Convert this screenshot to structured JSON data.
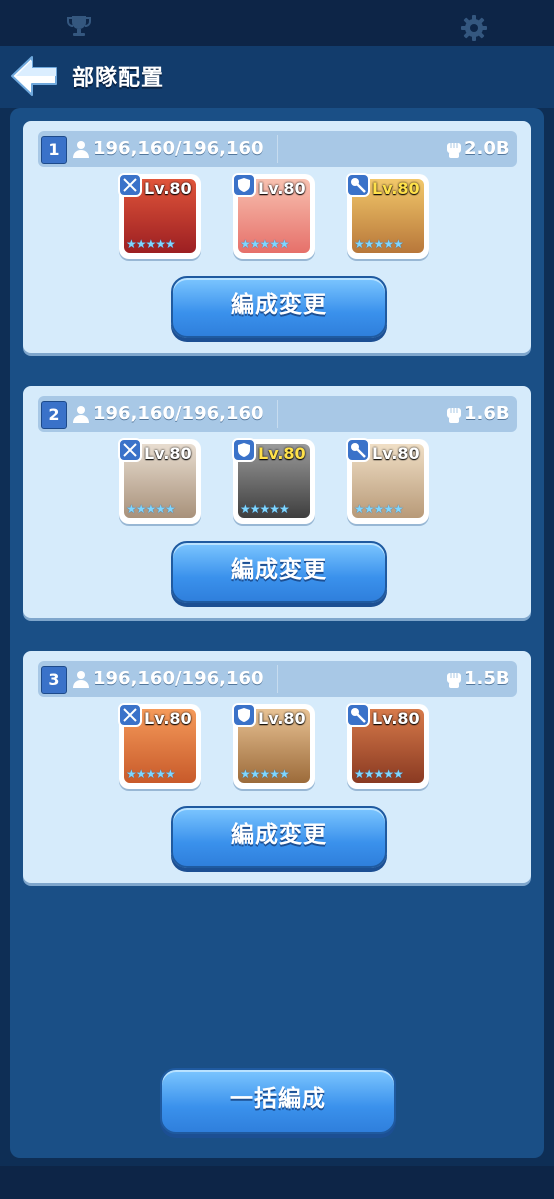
{
  "header": {
    "title": "部隊配置"
  },
  "squads": [
    {
      "number": "1",
      "troops": "196,160/196,160",
      "power": "2.0B",
      "heroes": [
        {
          "role": "crossbow-icon",
          "level": "Lv.80",
          "stars": "★★★★★",
          "portrait_color": "#c2302e",
          "level_color": "#ffffff"
        },
        {
          "role": "shield-icon",
          "level": "Lv.80",
          "stars": "★★★★★",
          "portrait_color": "#f29a8a",
          "level_color": "#ffffff"
        },
        {
          "role": "staff-icon",
          "level": "Lv.80",
          "stars": "★★★★★",
          "portrait_color": "#e0a24a",
          "level_color": "#ffe14a"
        }
      ],
      "change_label": "編成変更"
    },
    {
      "number": "2",
      "troops": "196,160/196,160",
      "power": "1.6B",
      "heroes": [
        {
          "role": "crossbow-icon",
          "level": "Lv.80",
          "stars": "★★★★★",
          "portrait_color": "#c9b9a8",
          "level_color": "#ffffff"
        },
        {
          "role": "shield-icon",
          "level": "Lv.80",
          "stars": "★★★★★",
          "portrait_color": "#6f6f6f",
          "level_color": "#ffe14a"
        },
        {
          "role": "staff-icon",
          "level": "Lv.80",
          "stars": "★★★★★",
          "portrait_color": "#d8c2a4",
          "level_color": "#ffffff"
        }
      ],
      "change_label": "編成変更"
    },
    {
      "number": "3",
      "troops": "196,160/196,160",
      "power": "1.5B",
      "heroes": [
        {
          "role": "crossbow-icon",
          "level": "Lv.80",
          "stars": "★★★★★",
          "portrait_color": "#e0783a",
          "level_color": "#ffffff"
        },
        {
          "role": "shield-icon",
          "level": "Lv.80",
          "stars": "★★★★★",
          "portrait_color": "#c79a6a",
          "level_color": "#ffffff"
        },
        {
          "role": "staff-icon",
          "level": "Lv.80",
          "stars": "★★★★★",
          "portrait_color": "#b5563a",
          "level_color": "#ffffff"
        }
      ],
      "change_label": "編成変更"
    }
  ],
  "bulk_button": {
    "label": "一括編成"
  },
  "colors": {
    "background": "#0e2e55",
    "panel": "#1a4f86",
    "card": "#d6ebfb",
    "button": "#3a91ec"
  }
}
